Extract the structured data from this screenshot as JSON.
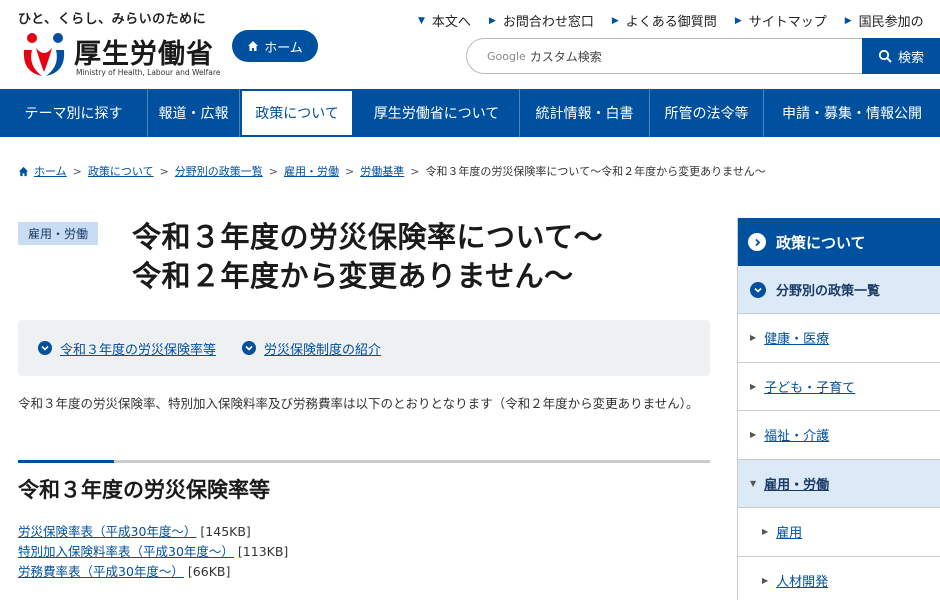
{
  "header": {
    "tagline": "ひと、くらし、みらいのために",
    "logo_text": "厚生労働省",
    "logo_sub": "Ministry of Health, Labour and Welfare",
    "home_label": "ホーム",
    "util_links": [
      "本文へ",
      "お問合わせ窓口",
      "よくある御質問",
      "サイトマップ",
      "国民参加の"
    ],
    "search_brand": "Google",
    "search_placeholder": "カスタム検索",
    "search_button": "検索"
  },
  "gnav": [
    {
      "label": "テーマ別に探す"
    },
    {
      "label": "報道・広報"
    },
    {
      "label": "政策について"
    },
    {
      "label": "厚生労働省について"
    },
    {
      "label": "統計情報・白書"
    },
    {
      "label": "所管の法令等"
    },
    {
      "label": "申請・募集・情報公開"
    }
  ],
  "breadcrumb": [
    "ホーム",
    "政策について",
    "分野別の政策一覧",
    "雇用・労働",
    "労働基準",
    "令和３年度の労災保険率について〜令和２年度から変更ありません〜"
  ],
  "main": {
    "category": "雇用・労働",
    "title_line1": "令和３年度の労災保険率について〜",
    "title_line2": "令和２年度から変更ありません〜",
    "anchors": [
      "令和３年度の労災保険率等",
      "労災保険制度の紹介"
    ],
    "lead": "令和３年度の労災保険率、特別加入保険料率及び労務費率は以下のとおりとなります（令和２年度から変更ありません）。",
    "section_title": "令和３年度の労災保険率等",
    "files": [
      {
        "label": "労災保険率表（平成30年度〜）",
        "size": "[145KB]"
      },
      {
        "label": "特別加入保険料率表（平成30年度〜）",
        "size": "[113KB]"
      },
      {
        "label": "労務費率表（平成30年度〜）",
        "size": "[66KB]"
      }
    ]
  },
  "sidebar": {
    "heading": "政策について",
    "sub": "分野別の政策一覧",
    "items": [
      "健康・医療",
      "子ども・子育て",
      "福祉・介護",
      "雇用・労働"
    ],
    "children": [
      "雇用",
      "人材開発"
    ]
  },
  "colors": {
    "brand": "#0050a0",
    "light": "#dce9f6",
    "panel": "#eef0f2"
  }
}
